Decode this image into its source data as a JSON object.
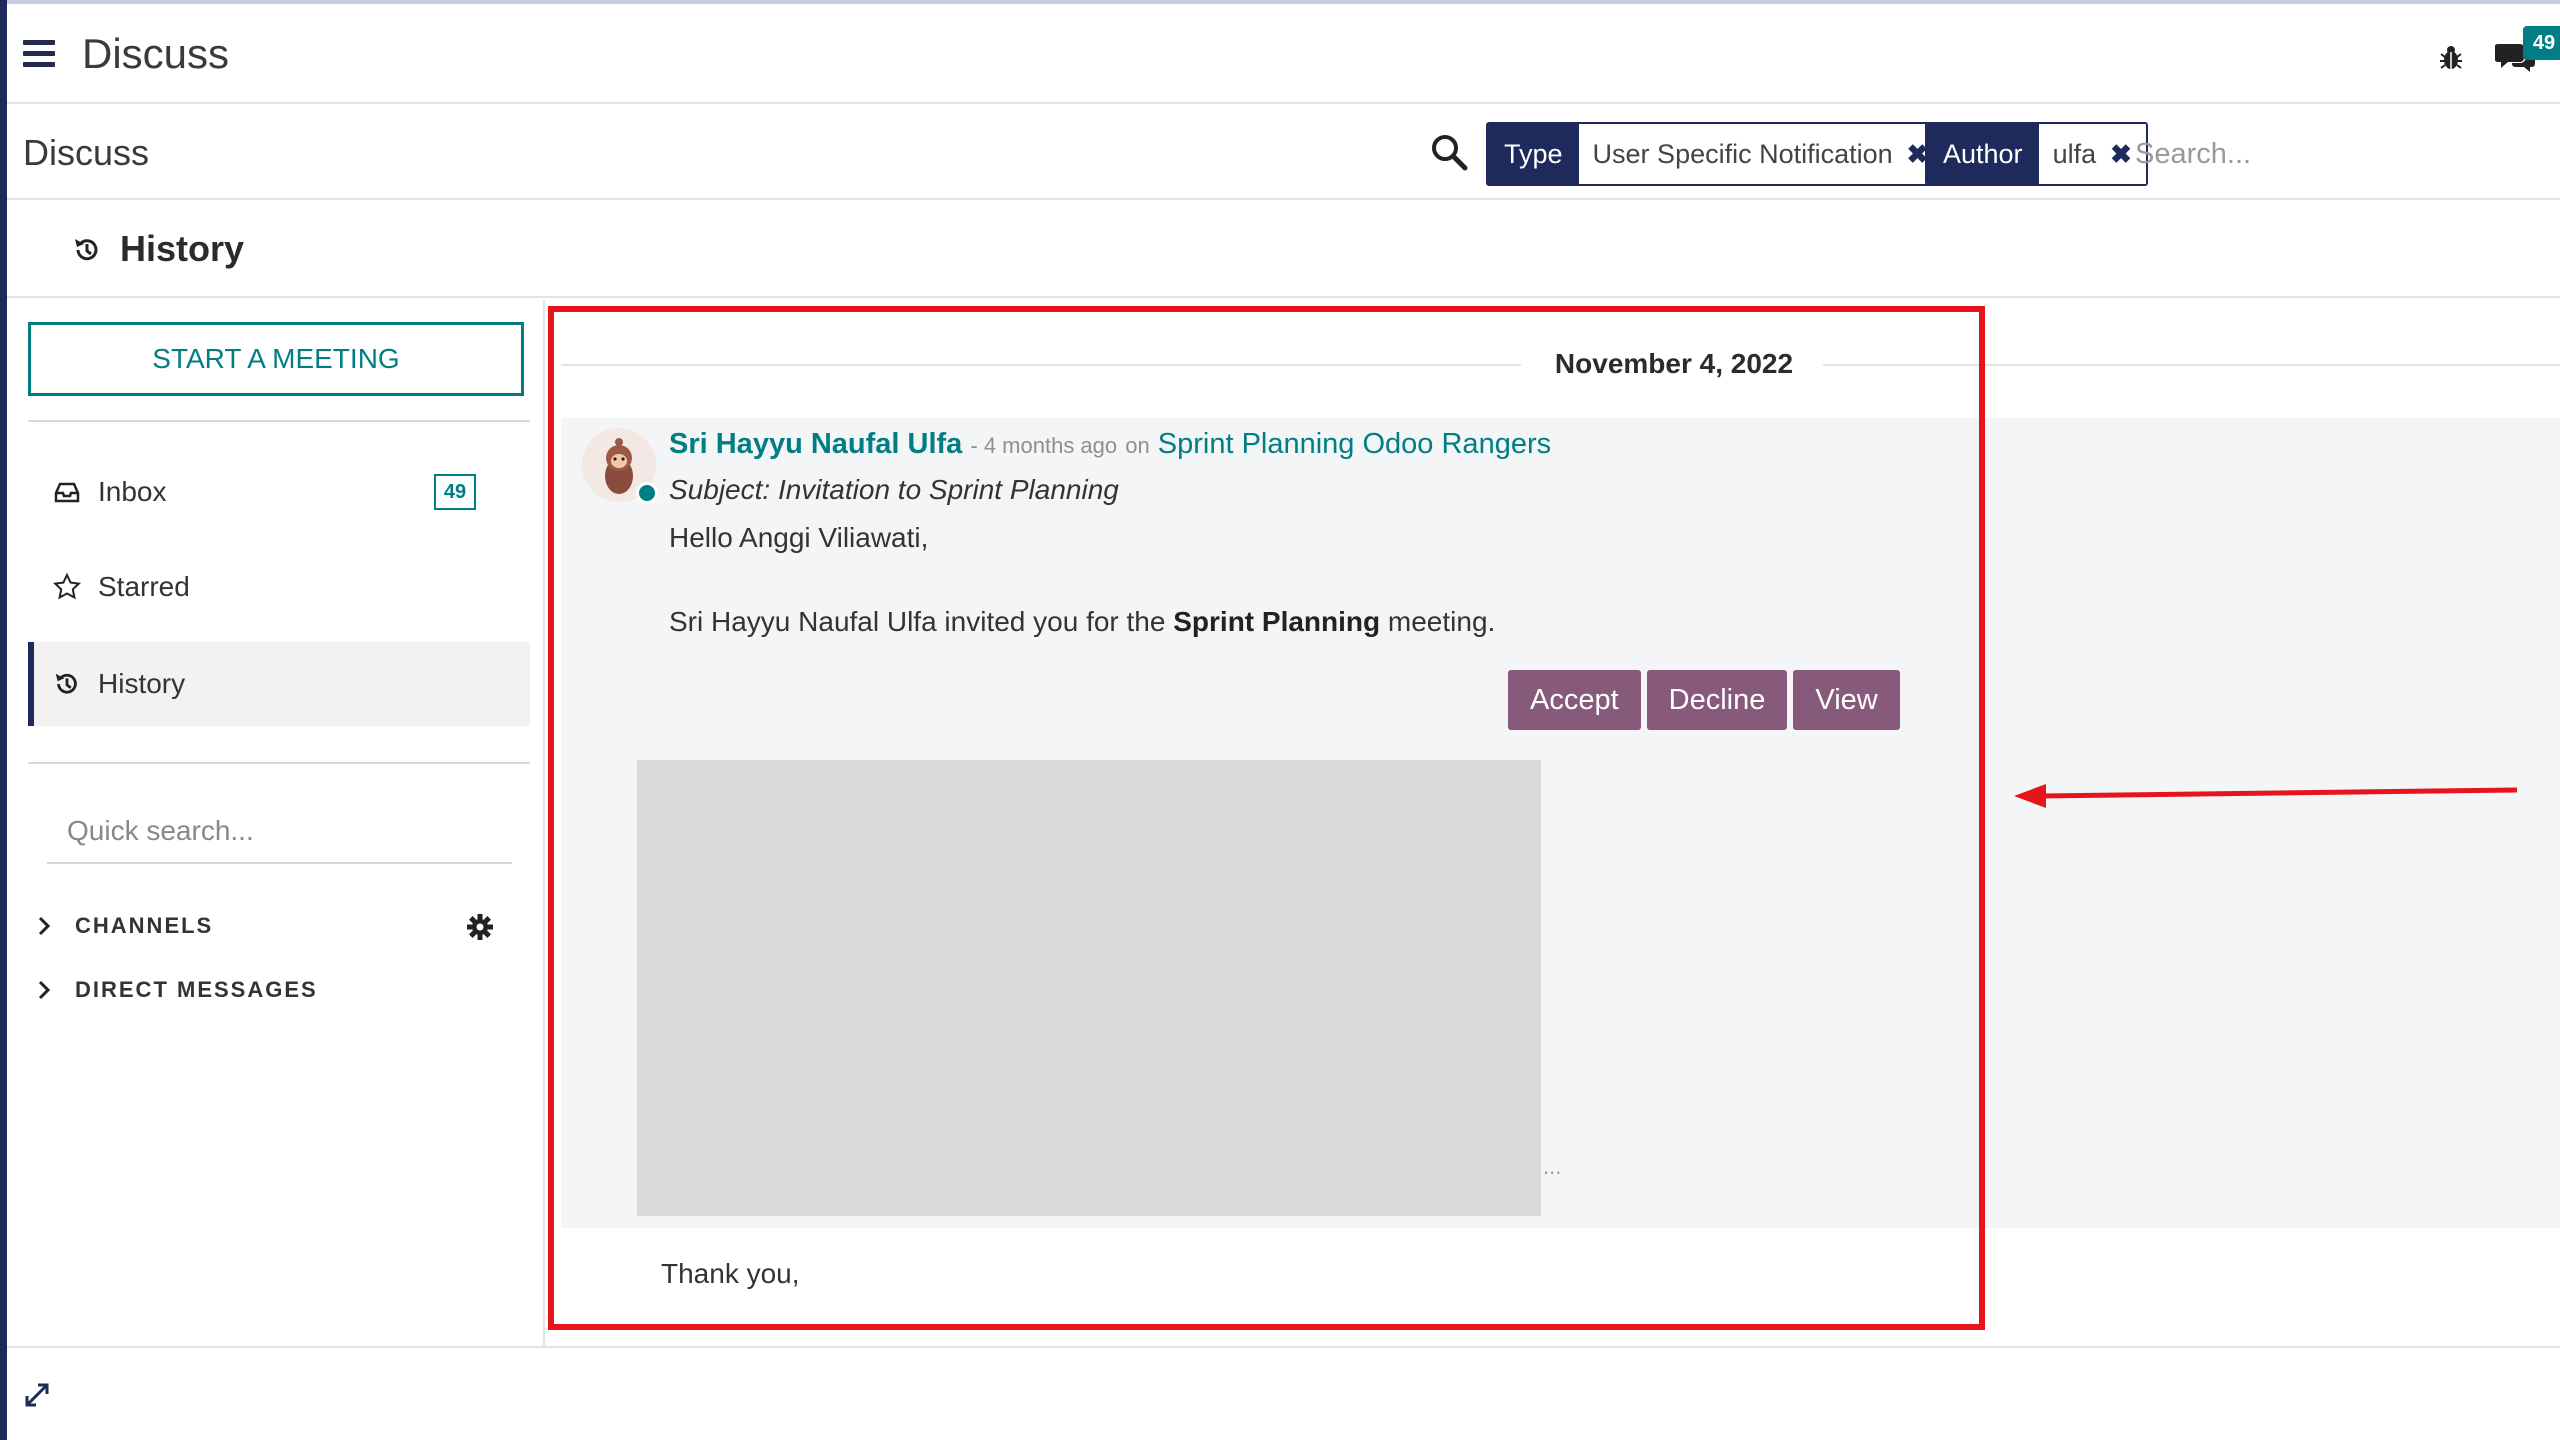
{
  "navbar": {
    "app_title": "Discuss",
    "notification_count": "49",
    "icons": [
      "menu-icon",
      "bug-icon",
      "chat-icon"
    ]
  },
  "control_panel": {
    "breadcrumb": "Discuss",
    "facets": [
      {
        "label": "Type",
        "value": "User Specific Notification"
      },
      {
        "label": "Author",
        "value": "ulfa"
      }
    ],
    "search_placeholder": "Search..."
  },
  "history_header": {
    "title": "History"
  },
  "sidebar": {
    "start_meeting_label": "START A MEETING",
    "items": [
      {
        "label": "Inbox",
        "icon": "inbox-icon",
        "badge": "49"
      },
      {
        "label": "Starred",
        "icon": "star-icon"
      },
      {
        "label": "History",
        "icon": "history-icon",
        "active": true
      }
    ],
    "quick_search_placeholder": "Quick search...",
    "categories": [
      {
        "label": "CHANNELS"
      },
      {
        "label": "DIRECT MESSAGES"
      }
    ]
  },
  "thread": {
    "date": "November 4, 2022",
    "message": {
      "author": "Sri Hayyu Naufal Ulfa",
      "time": "- 4 months ago",
      "on_label": "on",
      "origin": "Sprint Planning Odoo Rangers",
      "subject": "Subject: Invitation to Sprint Planning",
      "greeting": "Hello Anggi Viliawati,",
      "invite_prefix": "Sri Hayyu Naufal Ulfa invited you for the",
      "invite_event": "Sprint Planning",
      "invite_suffix": "meeting.",
      "buttons": {
        "accept": "Accept",
        "decline": "Decline",
        "view": "View"
      },
      "ellipsis": "...",
      "closing": "Thank you,"
    }
  },
  "colors": {
    "navy": "#1f2a5c",
    "teal": "#017e84",
    "odoo_purple": "#875a7b",
    "highlight_red": "#e8141c"
  }
}
